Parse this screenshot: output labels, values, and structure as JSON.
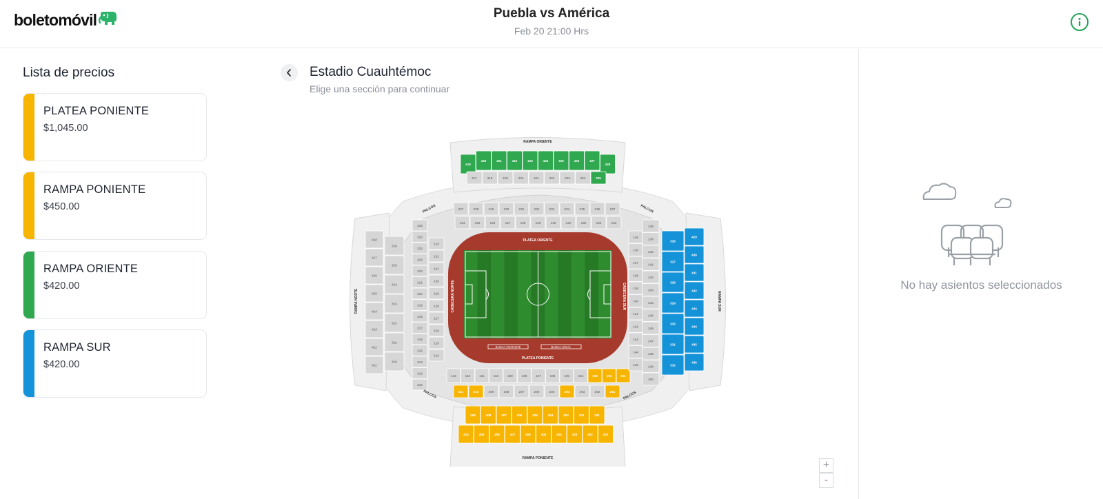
{
  "header": {
    "brand": "boletomóvil",
    "brand_icon": "elephant-logo-icon",
    "event_title": "Puebla vs América",
    "event_date": "Feb 20 21:00 Hrs",
    "info_icon": "info-icon",
    "accent": "#22a559"
  },
  "price_list": {
    "title": "Lista de precios",
    "items": [
      {
        "name": "PLATEA PONIENTE",
        "price": "$1,045.00",
        "color": "#f7b500"
      },
      {
        "name": "RAMPA PONIENTE",
        "price": "$450.00",
        "color": "#f7b500"
      },
      {
        "name": "RAMPA ORIENTE",
        "price": "$420.00",
        "color": "#2fa84f"
      },
      {
        "name": "RAMPA SUR",
        "price": "$420.00",
        "color": "#1593d9"
      }
    ]
  },
  "venue": {
    "back_icon": "chevron-left-icon",
    "title": "Estadio Cuauhtémoc",
    "subtitle": "Elige una sección para continuar",
    "zoom_in": "+",
    "zoom_out": "-",
    "map": {
      "stand_labels": {
        "rampa_oriente": "RAMPA ORIENTE",
        "rampa_poniente": "RAMPA PONIENTE",
        "rampa_norte": "RAMPA NORTE",
        "rampa_sur": "RAMPA SUR",
        "platea_oriente": "PLATEA ORIENTE",
        "platea_poniente": "PLATEA PONIENTE",
        "cabecera_norte": "CABECERA NORTE",
        "cabecera_sur": "CABECERA SUR",
        "palcos": "PALCOS",
        "banca_visitante": "BANCA VISITANTE",
        "banca_local": "BANCA LOCAL"
      },
      "top_ramp_sections": [
        "419",
        "420",
        "421",
        "422",
        "423",
        "424",
        "425",
        "426",
        "427",
        "428"
      ],
      "top_300_sections": [
        "317",
        "318",
        "319",
        "320",
        "321",
        "322",
        "323",
        "324",
        "325"
      ],
      "bottom_ramp_row1": [
        "309",
        "308",
        "307",
        "306",
        "305",
        "304",
        "303",
        "302",
        "301"
      ],
      "bottom_ramp_row2": [
        "410",
        "409",
        "408",
        "407",
        "406",
        "405",
        "404",
        "403",
        "402",
        "401"
      ],
      "right_ramp_300": [
        "326",
        "327",
        "328",
        "329",
        "330",
        "331",
        "332"
      ],
      "right_ramp_400": [
        "429",
        "430",
        "431",
        "432",
        "433",
        "434",
        "435",
        "436"
      ],
      "left_ramp_sections": [
        "418",
        "417",
        "416",
        "415",
        "414",
        "413",
        "412",
        "411"
      ],
      "left_300_sections": [
        "316",
        "315",
        "314",
        "313",
        "312",
        "311",
        "310"
      ],
      "top_200_sections": [
        "227",
        "228",
        "229",
        "230",
        "231",
        "232",
        "233",
        "234",
        "235",
        "236",
        "237"
      ],
      "top_100_sections": [
        "124",
        "125",
        "126",
        "127",
        "128",
        "129",
        "130",
        "131",
        "132",
        "133",
        "134"
      ],
      "bottom_200_sections": [
        "211",
        "210",
        "209",
        "208",
        "207",
        "206",
        "205",
        "204",
        "203",
        "202",
        "201"
      ],
      "bottom_100_sections": [
        "113",
        "112",
        "111",
        "110",
        "109",
        "108",
        "107",
        "106",
        "105",
        "104",
        "103",
        "102",
        "101"
      ],
      "left_200_sections": [
        "226",
        "225",
        "224",
        "223",
        "222",
        "221",
        "220",
        "219",
        "218",
        "217",
        "216",
        "215",
        "214",
        "213",
        "212"
      ],
      "left_100_sections": [
        "123",
        "122",
        "121",
        "120",
        "119",
        "118",
        "117",
        "116",
        "115",
        "114"
      ],
      "right_200_sections": [
        "238",
        "239",
        "240",
        "241",
        "242",
        "243",
        "244",
        "245",
        "246",
        "247",
        "248",
        "249",
        "250"
      ],
      "right_100_sections": [
        "135",
        "136",
        "137",
        "138",
        "139",
        "140",
        "141",
        "142",
        "143",
        "144",
        "145"
      ],
      "yellow_lower_sections": [
        "211",
        "210",
        "204",
        "103",
        "102",
        "101",
        "201"
      ],
      "colors": {
        "available_yellow": "#f7b500",
        "available_green": "#2fa84f",
        "available_blue": "#1593d9",
        "unavailable": "#d6d6d6",
        "track": "#a63a2c",
        "pitch": "#2e8b2e"
      }
    }
  },
  "selection": {
    "empty_icon": "empty-seats-icon",
    "empty_text": "No hay asientos seleccionados"
  }
}
